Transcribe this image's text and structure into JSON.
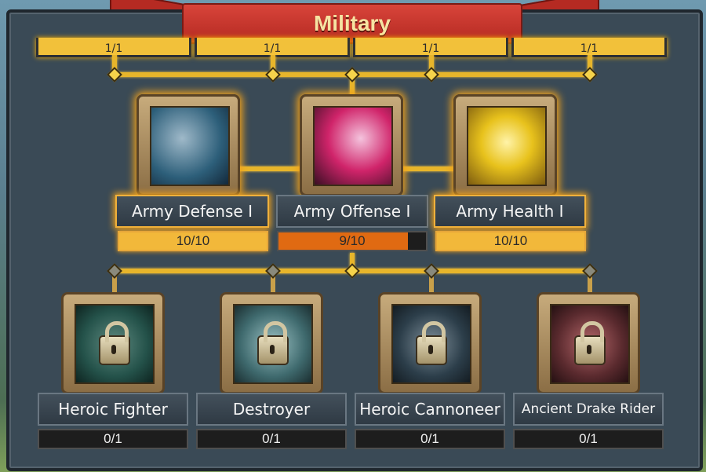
{
  "title": "Military",
  "top_row": [
    {
      "progress": "1/1"
    },
    {
      "progress": "1/1"
    },
    {
      "progress": "1/1"
    },
    {
      "progress": "1/1"
    }
  ],
  "tier2": [
    {
      "name": "Army Defense I",
      "progress": "10/10",
      "fill": 1.0,
      "art": "armored-knights-icon",
      "accent": "#2d5f7a"
    },
    {
      "name": "Army Offense I",
      "progress": "9/10",
      "fill": 0.9,
      "art": "dark-slasher-icon",
      "accent": "#d0246a"
    },
    {
      "name": "Army Health I",
      "progress": "10/10",
      "fill": 1.0,
      "art": "golem-warrior-icon",
      "accent": "#e8c21c"
    }
  ],
  "tier3": [
    {
      "name": "Heroic Fighter",
      "progress": "0/1",
      "locked": true,
      "art": "fighter-icon",
      "accent": "#24524a"
    },
    {
      "name": "Destroyer",
      "progress": "0/1",
      "locked": true,
      "art": "siege-cannon-icon",
      "accent": "#3f6a6e"
    },
    {
      "name": "Heroic Cannoneer",
      "progress": "0/1",
      "locked": true,
      "art": "cannoneer-icon",
      "accent": "#2c3e4a"
    },
    {
      "name": "Ancient Drake Rider",
      "progress": "0/1",
      "locked": true,
      "art": "drake-rider-icon",
      "accent": "#5a2a2e"
    }
  ]
}
